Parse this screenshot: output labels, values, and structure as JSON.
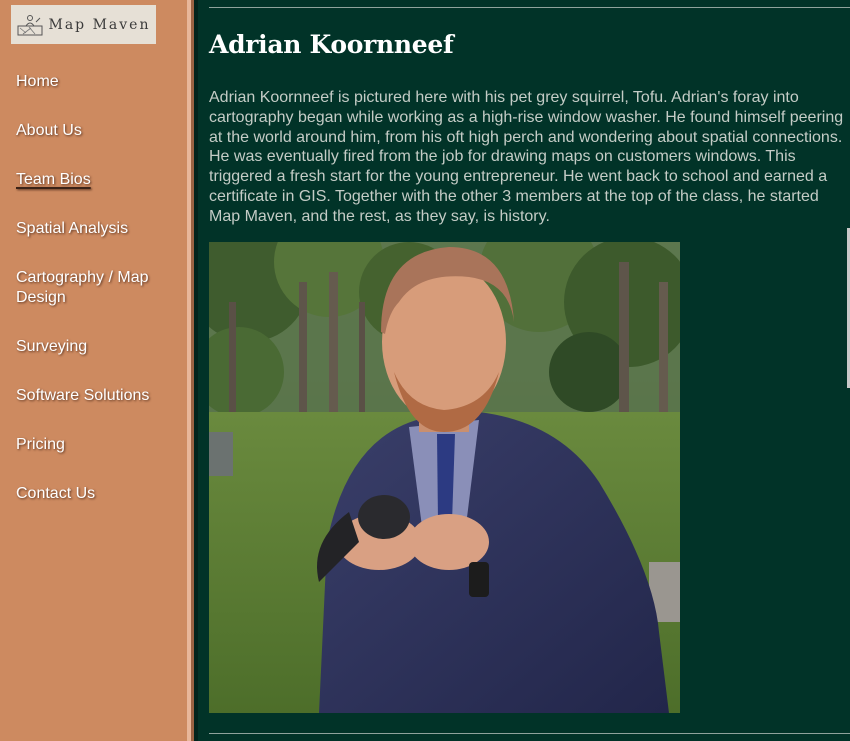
{
  "brand": {
    "name": "Map Maven"
  },
  "nav": {
    "items": [
      {
        "label": "Home"
      },
      {
        "label": "About Us"
      },
      {
        "label": "Team Bios"
      },
      {
        "label": "Spatial Analysis"
      },
      {
        "label": "Cartography / Map Design"
      },
      {
        "label": "Surveying"
      },
      {
        "label": "Software Solutions"
      },
      {
        "label": "Pricing"
      },
      {
        "label": "Contact Us"
      }
    ],
    "active": "Team Bios"
  },
  "main": {
    "title": "Adrian Koornneef",
    "bio": "Adrian Koornneef is pictured here with his pet grey squirrel, Tofu. Adrian's foray into cartography began while working as a high-rise window washer. He found himself peering at the world around him, from his oft high perch and wondering about spatial connections. He was eventually fired from the job for drawing maps on customers windows. This triggered a fresh start for the young entrepreneur. He went back to school and earned a certificate in GIS. Together with the other 3 members at the top of the class, he started Map Maven, and the rest, as they say, is history."
  },
  "colors": {
    "sidebar": "#cd8a60",
    "background": "#013328",
    "title": "#ffffff",
    "body_text": "#c4ccc6",
    "nav_text": "#ffffff"
  },
  "icons": {
    "logo": "map-person-icon"
  }
}
